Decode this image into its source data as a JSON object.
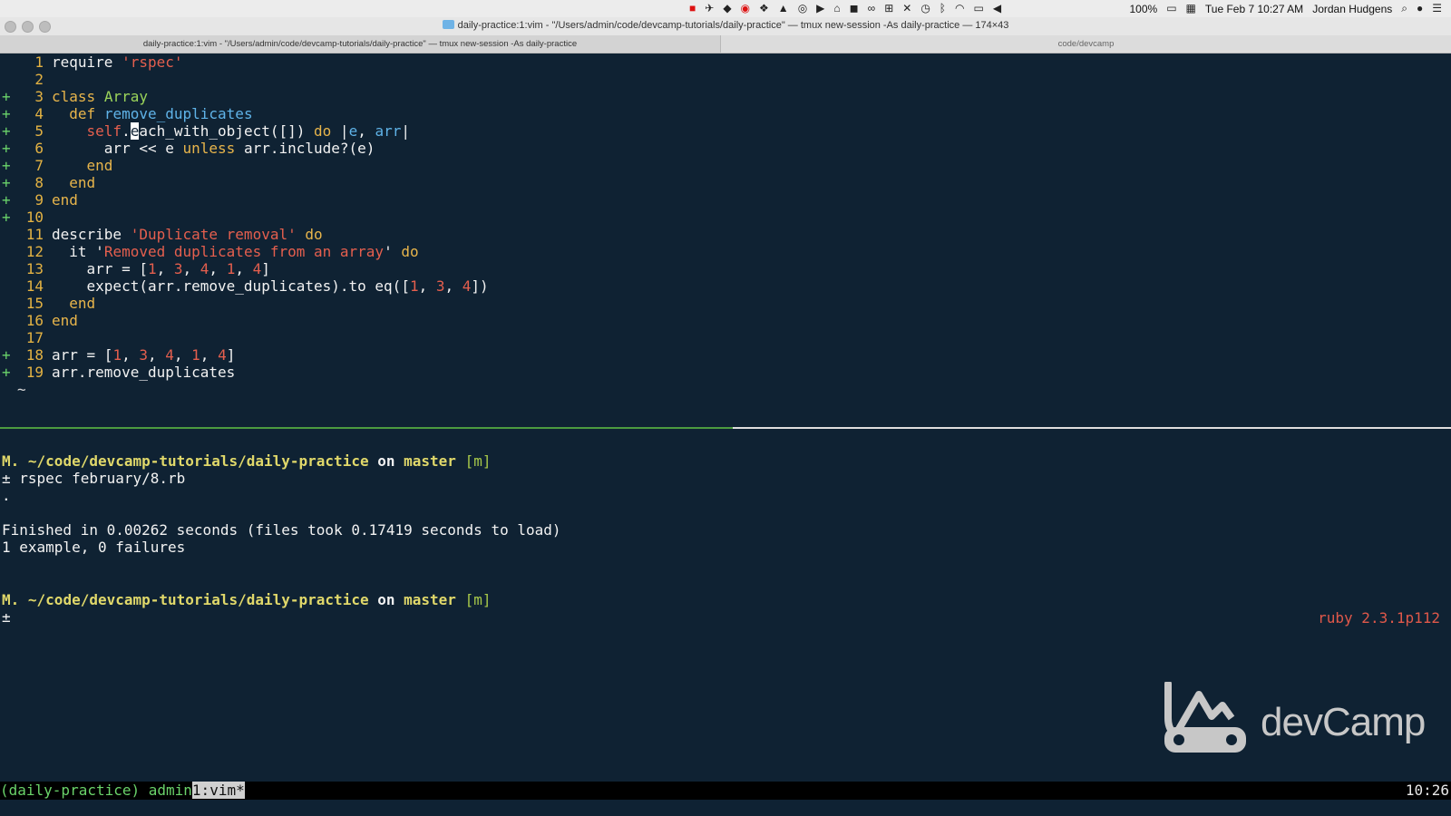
{
  "menubar": {
    "battery": "100%",
    "datetime": "Tue Feb 7  10:27 AM",
    "user": "Jordan Hudgens"
  },
  "window": {
    "title": "daily-practice:1:vim - \"/Users/admin/code/devcamp-tutorials/daily-practice\" — tmux new-session -As daily-practice — 174×43"
  },
  "tabs": [
    {
      "label": "daily-practice:1:vim - \"/Users/admin/code/devcamp-tutorials/daily-practice\" — tmux new-session -As daily-practice"
    },
    {
      "label": "code/devcamp"
    }
  ],
  "editor": {
    "line_numbers": [
      "1",
      "2",
      "3",
      "4",
      "5",
      "6",
      "7",
      "8",
      "9",
      "10",
      "11",
      "12",
      "13",
      "14",
      "15",
      "16",
      "17",
      "18",
      "19"
    ],
    "tokens": {
      "require": "require",
      "rspec_str": "'rspec'",
      "class": "class",
      "array": "Array",
      "def": "def",
      "remove_duplicates": "remove_duplicates",
      "self": "self",
      "dot": ".",
      "cursor_char": "e",
      "each_rest": "ach_with_object([])",
      "do": "do",
      "pipe_open": "|",
      "e": "e",
      "comma": ",",
      "arr": "arr",
      "pipe_close": "|",
      "arr_push": "arr << e",
      "unless": "unless",
      "include_part": "arr.include?(e)",
      "end": "end",
      "describe": "describe",
      "dup_removal": "'Duplicate removal'",
      "it": "it",
      "removed_str_quote": "'",
      "removed_str": "Removed duplicates from an array",
      "arr_assign": "arr = [",
      "n1": "1",
      "n3": "3",
      "n4": "4",
      "sep": ", ",
      "close_bracket": "]",
      "expect_part": "expect(arr.remove_duplicates).to eq([",
      "close_expect": "])",
      "arr_call": "arr.remove_duplicates",
      "plus": "+",
      "tilde": "~"
    }
  },
  "terminal": {
    "prompt_mark": "M.",
    "path": "~/code/devcamp-tutorials/daily-practice",
    "on": "on",
    "branch": "master",
    "branch_flag": "[m]",
    "command": "± rspec february/8.rb",
    "dot": ".",
    "finished": "Finished in 0.00262 seconds (files took 0.17419 seconds to load)",
    "summary": "1 example, 0 failures",
    "prompt2_char": "±",
    "ruby_version": "ruby 2.3.1p112"
  },
  "logo": {
    "text": "devCamp"
  },
  "tmux": {
    "session": "(daily-practice) admin",
    "window": "1:vim*",
    "clock": "10:26"
  }
}
